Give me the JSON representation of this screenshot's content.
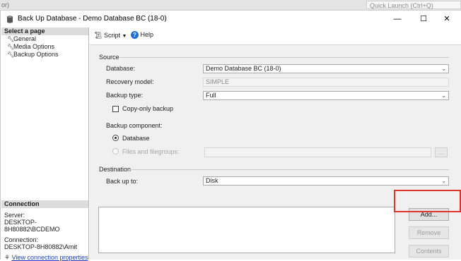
{
  "background_app": {
    "left_text": "or)",
    "quick_launch": "Quick Launch (Ctrl+Q)"
  },
  "window": {
    "title": "Back Up Database - Demo Database BC (18-0)",
    "controls": {
      "minimize": "—",
      "maximize": "☐",
      "close": "✕"
    }
  },
  "sidebar": {
    "select_page_header": "Select a page",
    "pages": [
      {
        "label": "General",
        "icon": "wrench-icon"
      },
      {
        "label": "Media Options",
        "icon": "wrench-icon"
      },
      {
        "label": "Backup Options",
        "icon": "wrench-icon"
      }
    ],
    "connection": {
      "header": "Connection",
      "server_label": "Server:",
      "server_value": "DESKTOP-8H80882\\BCDEMO",
      "connection_label": "Connection:",
      "connection_value": "DESKTOP-8H80882\\Amit",
      "view_properties_link": "View connection properties"
    }
  },
  "toolbar": {
    "script_label": "Script",
    "help_label": "Help"
  },
  "source": {
    "group_title": "Source",
    "database_label": "Database:",
    "database_value": "Demo Database BC (18-0)",
    "recovery_model_label": "Recovery model:",
    "recovery_model_value": "SIMPLE",
    "backup_type_label": "Backup type:",
    "backup_type_value": "Full",
    "copy_only_label": "Copy-only backup",
    "copy_only_checked": false,
    "backup_component_label": "Backup component:",
    "component_database_label": "Database",
    "component_files_label": "Files and filegroups:",
    "component_selected": "Database",
    "browse_label": "..."
  },
  "destination": {
    "group_title": "Destination",
    "back_up_to_label": "Back up to:",
    "back_up_to_value": "Disk",
    "add_button": "Add...",
    "remove_button": "Remove",
    "contents_button": "Contents"
  },
  "colors": {
    "highlight": "#e0342d",
    "link": "#1a3fb8",
    "panel_bg": "#f0f0f0"
  }
}
